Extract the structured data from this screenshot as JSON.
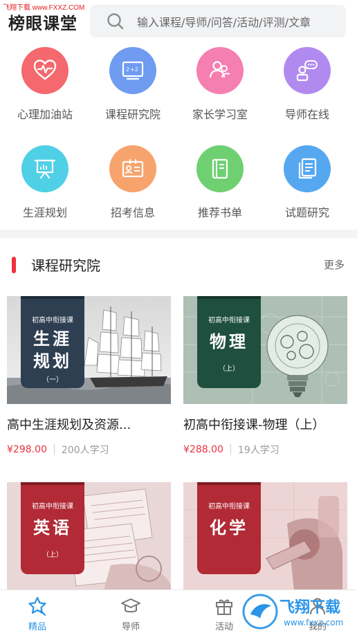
{
  "watermark_top": "飞翔下载 www.FXXZ.COM",
  "header": {
    "title": "榜眼课堂",
    "search_placeholder": "输入课程/导师/问答/活动/评测/文章"
  },
  "categories": [
    {
      "label": "心理加油站",
      "color": "#f4686e",
      "icon": "heart-pulse-icon"
    },
    {
      "label": "课程研究院",
      "color": "#6f9cf0",
      "icon": "blackboard-icon"
    },
    {
      "label": "家长学习室",
      "color": "#f57fb0",
      "icon": "parents-icon"
    },
    {
      "label": "导师在线",
      "color": "#b18af0",
      "icon": "chat-user-icon"
    },
    {
      "label": "生涯规划",
      "color": "#4fd0e6",
      "icon": "presentation-icon"
    },
    {
      "label": "招考信息",
      "color": "#f7a36d",
      "icon": "id-card-icon"
    },
    {
      "label": "推荐书单",
      "color": "#6fd072",
      "icon": "book-icon"
    },
    {
      "label": "试题研究",
      "color": "#55a8f0",
      "icon": "document-icon"
    }
  ],
  "section": {
    "title": "课程研究院",
    "more": "更多"
  },
  "courses": [
    {
      "badge_small": "初高中衔接课",
      "badge_line1": "生涯",
      "badge_line2": "规划",
      "badge_sub": "（一）",
      "badge_color": "#2f3f52",
      "title": "高中生涯规划及资源...",
      "price": "¥298.00",
      "students": "200人学习"
    },
    {
      "badge_small": "初高中衔接课",
      "badge_line1": "物理",
      "badge_line2": "",
      "badge_sub": "（上）",
      "badge_color": "#1f4f3f",
      "title": "初高中衔接课-物理（上）",
      "price": "¥288.00",
      "students": "19人学习"
    },
    {
      "badge_small": "初高中衔接课",
      "badge_line1": "英语",
      "badge_line2": "",
      "badge_sub": "（上）",
      "badge_color": "#b12a35",
      "title": "",
      "price": "",
      "students": ""
    },
    {
      "badge_small": "初高中衔接课",
      "badge_line1": "化学",
      "badge_line2": "",
      "badge_sub": "",
      "badge_color": "#b12a35",
      "title": "",
      "price": "",
      "students": ""
    }
  ],
  "nav": [
    {
      "label": "精品",
      "active": true
    },
    {
      "label": "导师",
      "active": false
    },
    {
      "label": "活动",
      "active": false
    },
    {
      "label": "我的",
      "active": false
    }
  ],
  "watermark_logo": {
    "text": "飞翔下载",
    "url": "www.fxxz.com"
  },
  "colors": {
    "accent": "#2a95e8",
    "price": "#e8323c",
    "section_bar": "#f0323c"
  }
}
